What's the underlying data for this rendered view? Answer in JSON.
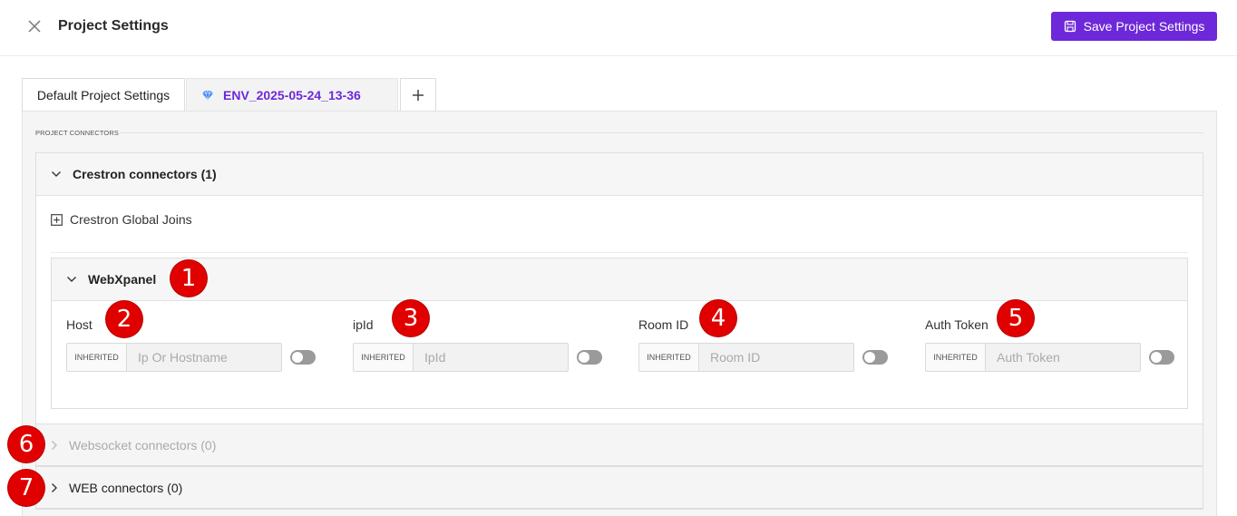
{
  "header": {
    "title": "Project Settings",
    "save_label": "Save Project Settings"
  },
  "tabs": [
    {
      "label": "Default Project Settings",
      "active": true
    },
    {
      "label": "ENV_2025-05-24_13-36",
      "icon": "diamond-icon"
    }
  ],
  "section": {
    "label": "PROJECT CONNECTORS"
  },
  "crestron": {
    "title": "Crestron connectors (1)",
    "global_joins_label": "Crestron Global Joins",
    "webxpanel": {
      "title": "WebXpanel",
      "fields": [
        {
          "label": "Host",
          "badge": "INHERITED",
          "placeholder": "Ip Or Hostname"
        },
        {
          "label": "ipId",
          "badge": "INHERITED",
          "placeholder": "IpId"
        },
        {
          "label": "Room ID",
          "badge": "INHERITED",
          "placeholder": "Room ID"
        },
        {
          "label": "Auth Token",
          "badge": "INHERITED",
          "placeholder": "Auth Token"
        }
      ]
    }
  },
  "websocket": {
    "title": "Websocket connectors (0)"
  },
  "web": {
    "title": "WEB connectors (0)"
  },
  "annotations": [
    "1",
    "2",
    "3",
    "4",
    "5",
    "6",
    "7"
  ],
  "colors": {
    "accent": "#6d28d9",
    "annotation": "#e00000"
  }
}
